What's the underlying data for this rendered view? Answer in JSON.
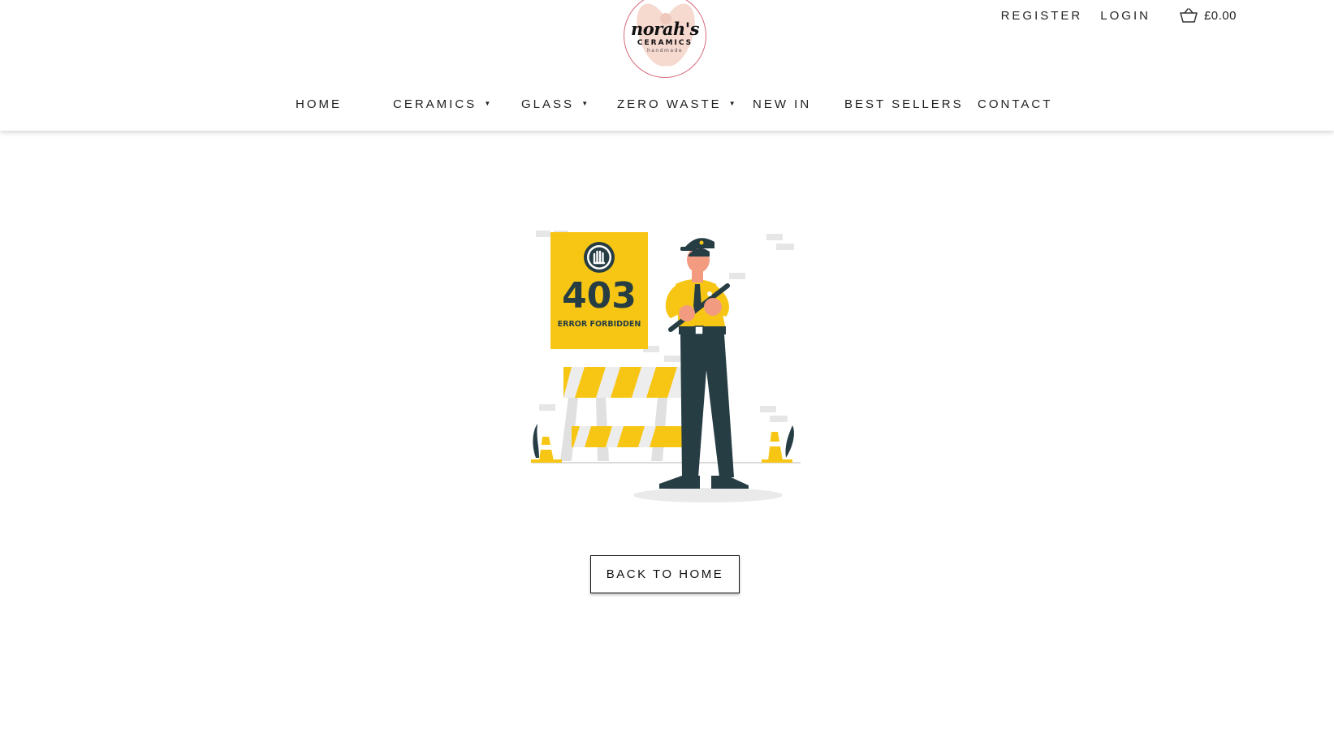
{
  "logo": {
    "script": "norah's",
    "sub": "CERAMICS",
    "tiny": "handmade"
  },
  "top_links": {
    "register": "REGISTER",
    "login": "LOGIN",
    "cart_total": "£0.00"
  },
  "nav": [
    {
      "label": "HOME"
    },
    {
      "label": "CERAMICS",
      "caret": "▼"
    },
    {
      "label": "GLASS",
      "caret": "▼"
    },
    {
      "label": "ZERO WASTE",
      "caret": "▼"
    },
    {
      "label": "NEW IN"
    },
    {
      "label": "BEST SELLERS"
    },
    {
      "label": "CONTACT"
    }
  ],
  "error": {
    "code": "403",
    "text": "ERROR FORBIDDEN"
  },
  "back_button": "BACK TO HOME",
  "colors": {
    "accent_yellow": "#f7c614",
    "dark_teal": "#263d44",
    "logo_ring": "#d6687a",
    "skin": "#f29b80"
  }
}
